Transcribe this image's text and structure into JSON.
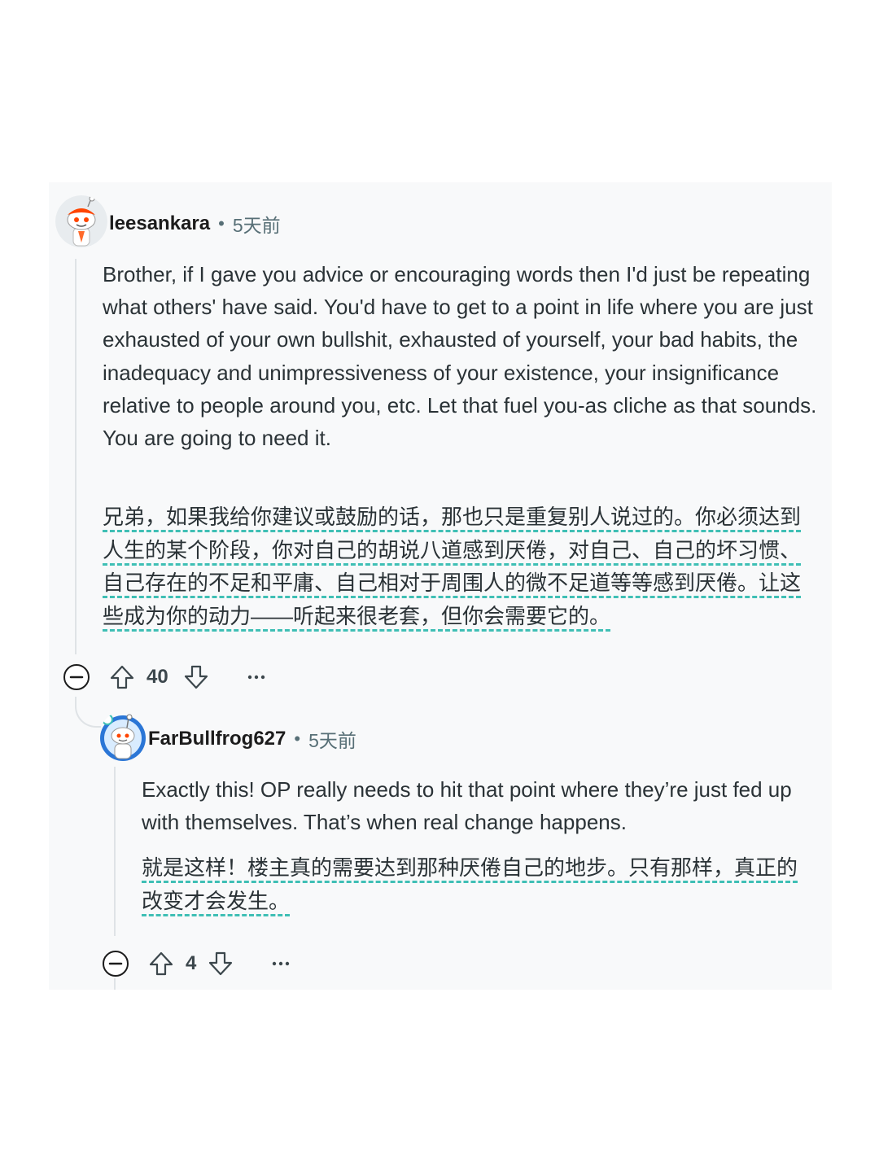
{
  "comments": [
    {
      "username": "leesankara",
      "separator": "•",
      "time": "5天前",
      "body_en": "Brother, if I gave you advice or encouraging words then I'd just be repeating what others' have said. You'd have to get to a point in life where you are just exhausted of your own bullshit, exhausted of yourself, your bad habits, the inadequacy and unimpressiveness of your existence, your insignificance relative to people around you, etc. Let that fuel you-as cliche as that sounds. You are going to need it.",
      "body_zh": "兄弟，如果我给你建议或鼓励的话，那也只是重复别人说过的。你必须达到人生的某个阶段，你对自己的胡说八道感到厌倦，对自己、自己的坏习惯、自己存在的不足和平庸、自己相对于周围人的微不足道等等感到厌倦。让这些成为你的动力——听起来很老套，但你会需要它的。",
      "votes": "40",
      "icons": {
        "avatar": "snoo-avatar",
        "collapse": "collapse-minus-icon",
        "upvote": "upvote-arrow-icon",
        "downvote": "downvote-arrow-icon",
        "more": "more-dots-icon"
      }
    },
    {
      "username": "FarBullfrog627",
      "separator": "•",
      "time": "5天前",
      "body_en": "Exactly this! OP really needs to hit that point where they’re just fed up with themselves. That’s when real change happens.",
      "body_zh": "就是这样！楼主真的需要达到那种厌倦自己的地步。只有那样，真正的改变才会发生。",
      "votes": "4",
      "icons": {
        "avatar": "snoo-avatar",
        "collapse": "collapse-minus-icon",
        "upvote": "upvote-arrow-icon",
        "downvote": "downvote-arrow-icon",
        "more": "more-dots-icon"
      }
    }
  ],
  "colors": {
    "card_background": "#f8f9fa",
    "thread_line": "#dfe3e6",
    "translation_underline": "#3fbfb5",
    "meta_text": "#576f76"
  }
}
